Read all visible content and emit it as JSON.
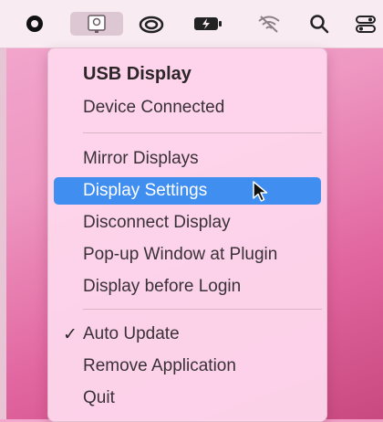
{
  "menubar": {
    "icons": [
      "record-icon",
      "usb-display-icon",
      "creative-cloud-icon",
      "battery-charging-icon",
      "wifi-off-icon",
      "search-icon",
      "control-center-icon"
    ]
  },
  "menu": {
    "title": "USB Display",
    "status": "Device Connected",
    "items_group1": [
      "Mirror Displays",
      "Display Settings",
      "Disconnect Display",
      "Pop-up Window at Plugin",
      "Display before Login"
    ],
    "highlighted": "Display Settings",
    "items_group2": [
      "Auto Update",
      "Remove Application",
      "Quit"
    ],
    "checked": "Auto Update",
    "check_glyph": "✓"
  },
  "colors": {
    "highlight": "#3f8ef0",
    "menu_bg": "#fdd6ec",
    "desktop": "#e1659f"
  }
}
